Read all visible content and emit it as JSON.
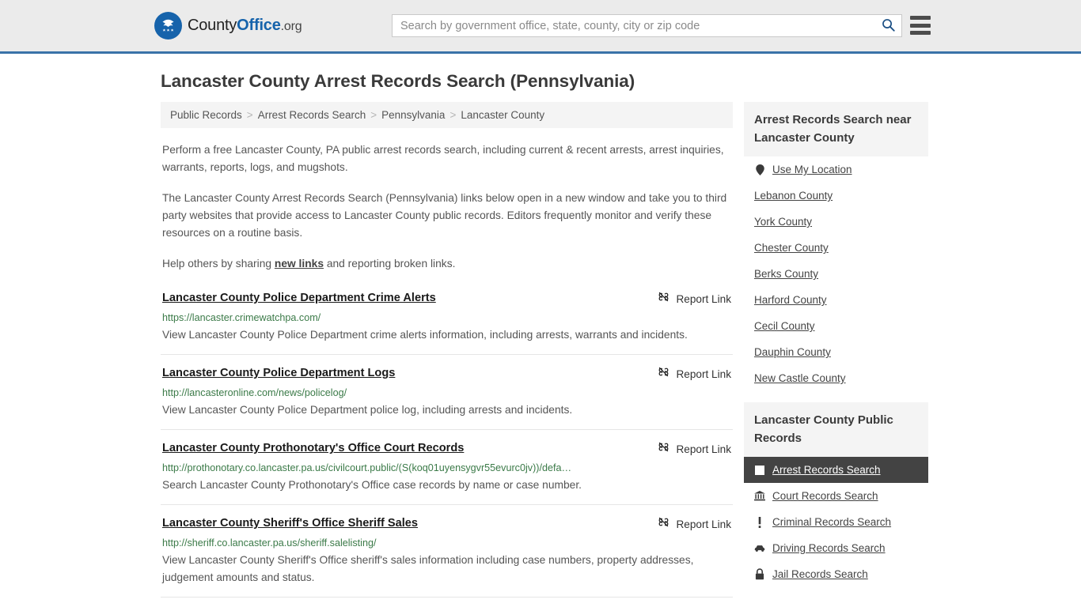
{
  "header": {
    "brand": {
      "part1": "County",
      "part2": "Office",
      "part3": ".org"
    },
    "search": {
      "placeholder": "Search by government office, state, county, city or zip code",
      "value": ""
    },
    "search_icon": "search-icon",
    "menu_icon": "hamburger-menu-icon",
    "border_color": "#3a72a8",
    "background_color": "#ebebeb"
  },
  "page": {
    "title": "Lancaster County Arrest Records Search (Pennsylvania)"
  },
  "breadcrumb": {
    "items": [
      {
        "label": "Public Records"
      },
      {
        "label": "Arrest Records Search"
      },
      {
        "label": "Pennsylvania"
      },
      {
        "label": "Lancaster County"
      }
    ],
    "separator": ">"
  },
  "intro": {
    "paragraph1": "Perform a free Lancaster County, PA public arrest records search, including current & recent arrests, arrest inquiries, warrants, reports, logs, and mugshots.",
    "paragraph2": "The Lancaster County Arrest Records Search (Pennsylvania) links below open in a new window and take you to third party websites that provide access to Lancaster County public records. Editors frequently monitor and verify these resources on a routine basis.",
    "paragraph3_before": "Help others by sharing ",
    "paragraph3_link": "new links",
    "paragraph3_after": " and reporting broken links."
  },
  "results": {
    "report_label": "Report Link",
    "report_icon": "broken-link-icon",
    "items": [
      {
        "title": "Lancaster County Police Department Crime Alerts",
        "url": "https://lancaster.crimewatchpa.com/",
        "description": "View Lancaster County Police Department crime alerts information, including arrests, warrants and incidents."
      },
      {
        "title": "Lancaster County Police Department Logs",
        "url": "http://lancasteronline.com/news/policelog/",
        "description": "View Lancaster County Police Department police log, including arrests and incidents."
      },
      {
        "title": "Lancaster County Prothonotary's Office Court Records",
        "url": "http://prothonotary.co.lancaster.pa.us/civilcourt.public/(S(koq01uyensygvr55evurc0jv))/defa…",
        "description": "Search Lancaster County Prothonotary's Office case records by name or case number."
      },
      {
        "title": "Lancaster County Sheriff's Office Sheriff Sales",
        "url": "http://sheriff.co.lancaster.pa.us/sheriff.salelisting/",
        "description": "View Lancaster County Sheriff's Office sheriff's sales information including case numbers, property addresses, judgement amounts and status."
      }
    ]
  },
  "sidebar": {
    "nearby": {
      "heading": "Arrest Records Search near Lancaster County",
      "items": [
        {
          "label": "Use My Location",
          "icon": "map-pin-icon"
        },
        {
          "label": "Lebanon County",
          "icon": ""
        },
        {
          "label": "York County",
          "icon": ""
        },
        {
          "label": "Chester County",
          "icon": ""
        },
        {
          "label": "Berks County",
          "icon": ""
        },
        {
          "label": "Harford County",
          "icon": ""
        },
        {
          "label": "Cecil County",
          "icon": ""
        },
        {
          "label": "Dauphin County",
          "icon": ""
        },
        {
          "label": "New Castle County",
          "icon": ""
        }
      ]
    },
    "public_records": {
      "heading": "Lancaster County Public Records",
      "items": [
        {
          "label": "Arrest Records Search",
          "icon": "square-icon",
          "active": true
        },
        {
          "label": "Court Records Search",
          "icon": "courthouse-icon",
          "active": false
        },
        {
          "label": "Criminal Records Search",
          "icon": "exclamation-icon",
          "active": false
        },
        {
          "label": "Driving Records Search",
          "icon": "car-icon",
          "active": false
        },
        {
          "label": "Jail Records Search",
          "icon": "lock-icon",
          "active": false
        }
      ]
    }
  }
}
